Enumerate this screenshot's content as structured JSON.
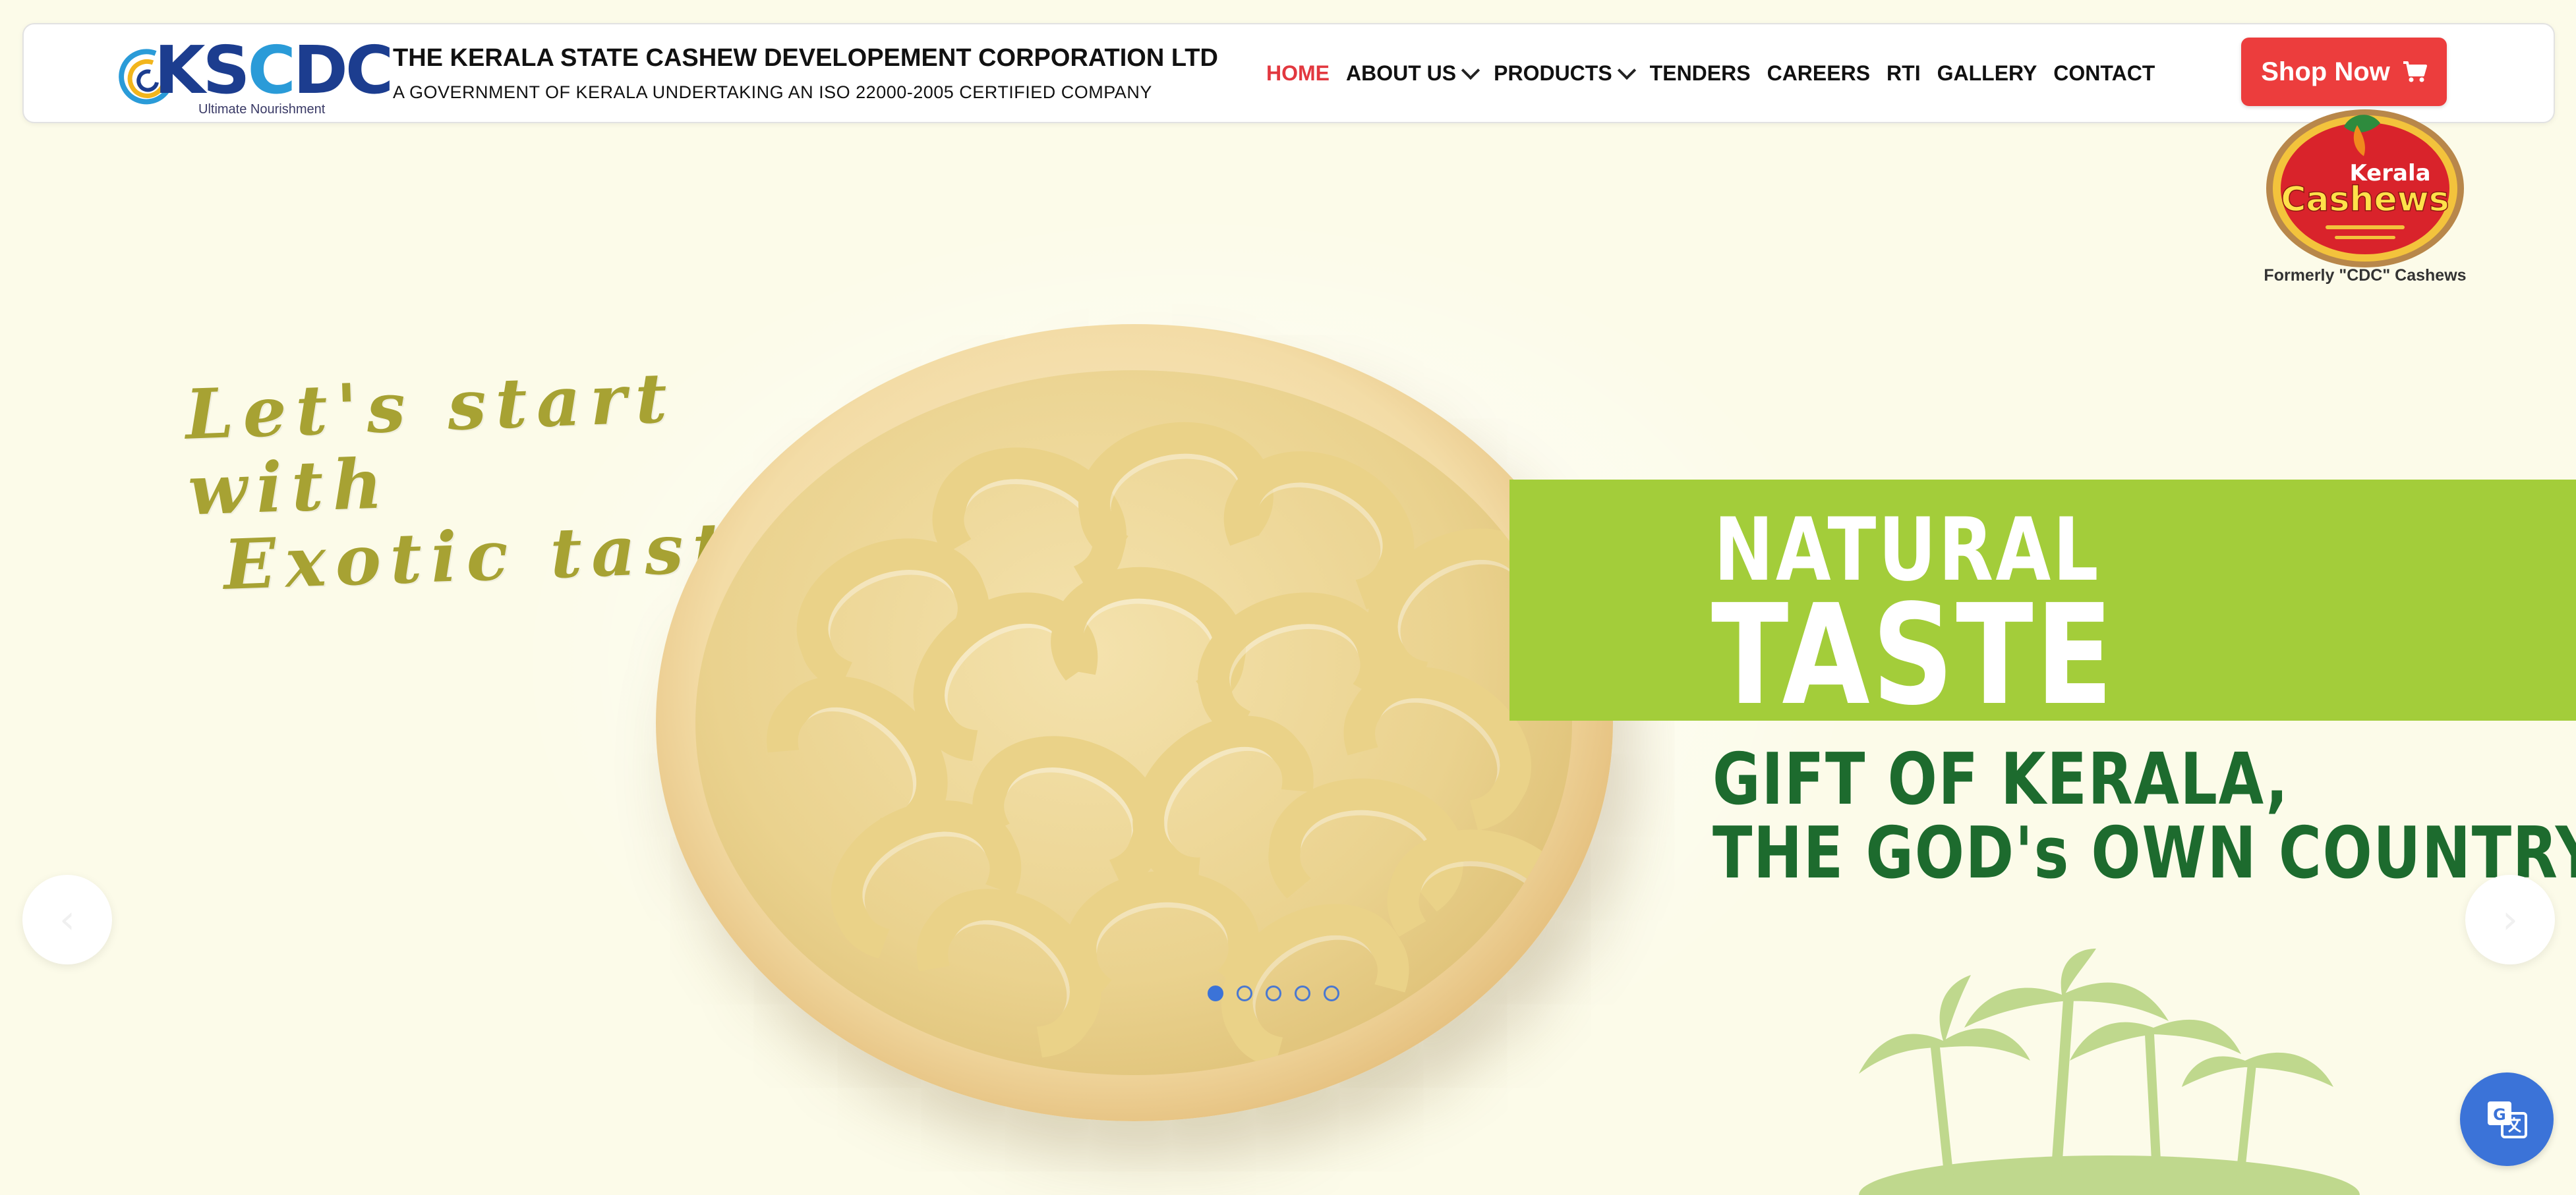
{
  "header": {
    "logo_text": "KSCDC",
    "logo_tagline": "Ultimate Nourishment",
    "company_name": "THE KERALA STATE CASHEW DEVELOPEMENT CORPORATION LTD",
    "company_subtitle": "A GOVERNMENT OF KERALA UNDERTAKING AN ISO 22000-2005 CERTIFIED COMPANY"
  },
  "nav": {
    "items": [
      {
        "label": "HOME",
        "active": true
      },
      {
        "label": "ABOUT US",
        "dropdown": true
      },
      {
        "label": "PRODUCTS",
        "dropdown": true
      },
      {
        "label": "TENDERS"
      },
      {
        "label": "CAREERS"
      },
      {
        "label": "RTI"
      },
      {
        "label": "GALLERY"
      },
      {
        "label": "CONTACT"
      }
    ],
    "shop_label": "Shop Now"
  },
  "badge": {
    "brand_top": "Kerala",
    "brand_main": "Cashews",
    "caption": "Formerly \"CDC\" Cashews"
  },
  "hero": {
    "script_line1": "Let's  start  with",
    "script_line2": "Exotic  taste",
    "headline_small": "NATURAL",
    "headline_big": "TASTE",
    "gift_line1": "GIFT OF KERALA,",
    "gift_line2": "THE GOD's OWN COUNTRY"
  },
  "carousel": {
    "slide_count": 5,
    "active_index": 0
  },
  "colors": {
    "accent_red": "#ec3d3d",
    "nav_active": "#e2383f",
    "band_green": "#a3cd3a",
    "text_green": "#1d6b2e",
    "script_olive": "#a7a233",
    "dot_blue": "#3b73d8"
  },
  "icons": [
    "cart-icon",
    "chevron-down-icon",
    "arrow-left-icon",
    "arrow-right-icon",
    "translate-icon"
  ]
}
